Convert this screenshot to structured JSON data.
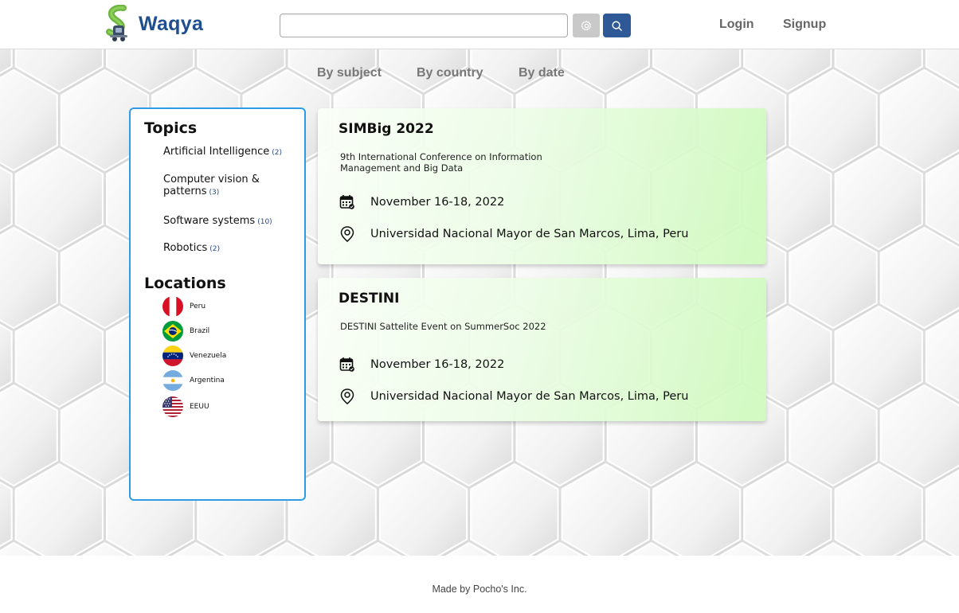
{
  "header": {
    "brand": "Waqya",
    "search": {
      "value": "",
      "placeholder": ""
    },
    "login_label": "Login",
    "signup_label": "Signup",
    "icons": {
      "settings": "gear-icon",
      "search": "search-icon"
    },
    "colors": {
      "brand": "#1f4f8f",
      "search_button": "#2f5896",
      "settings_button": "#c9c9c9"
    }
  },
  "tabs": [
    {
      "label": "By subject"
    },
    {
      "label": "By country"
    },
    {
      "label": "By date"
    }
  ],
  "sidebar": {
    "topics_heading": "Topics",
    "topics": [
      {
        "label": "Artificial Intelligence",
        "count": "(2)"
      },
      {
        "label": "Computer vision & patterns",
        "count": "(3)"
      },
      {
        "label": "Software systems",
        "count": "(10)"
      },
      {
        "label": "Robotics",
        "count": "(2)"
      }
    ],
    "locations_heading": "Locations",
    "locations": [
      {
        "label": "Peru",
        "flag": "peru-flag-icon"
      },
      {
        "label": "Brazil",
        "flag": "brazil-flag-icon"
      },
      {
        "label": "Venezuela",
        "flag": "venezuela-flag-icon"
      },
      {
        "label": "Argentina",
        "flag": "argentina-flag-icon"
      },
      {
        "label": "EEUU",
        "flag": "usa-flag-icon"
      }
    ],
    "border_color": "#2e9be6"
  },
  "events": [
    {
      "title": "SIMBig 2022",
      "description": "9th International Conference on Information Management and Big Data",
      "date": "November 16-18, 2022",
      "location": "Universidad Nacional Mayor de San Marcos, Lima, Peru"
    },
    {
      "title": "DESTINI",
      "description": "DESTINI Sattelite Event on SummerSoc 2022",
      "date": "November 16-18, 2022",
      "location": "Universidad Nacional Mayor de San Marcos, Lima, Peru"
    }
  ],
  "footer": {
    "text": "Made by  Pocho's Inc."
  }
}
